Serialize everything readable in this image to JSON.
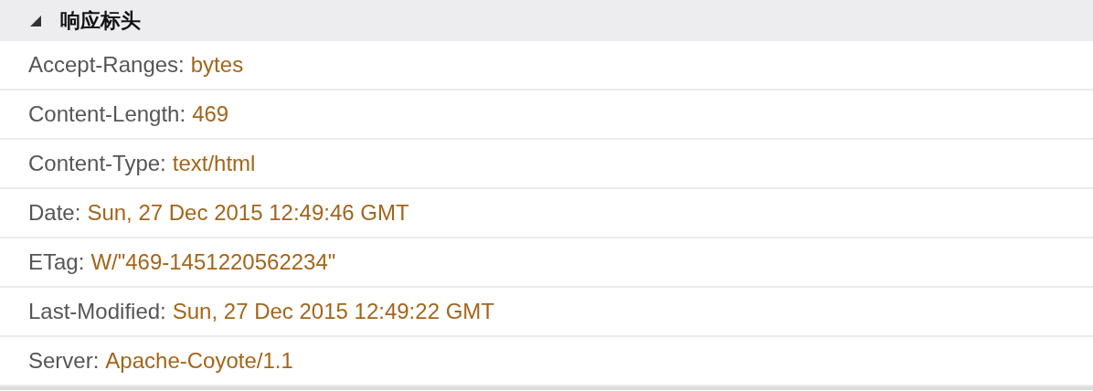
{
  "section": {
    "title": "响应标头",
    "expanded": true,
    "headers": [
      {
        "name": "Accept-Ranges:",
        "value": "bytes"
      },
      {
        "name": "Content-Length:",
        "value": "469"
      },
      {
        "name": "Content-Type:",
        "value": "text/html"
      },
      {
        "name": "Date:",
        "value": "Sun, 27 Dec 2015 12:49:46 GMT"
      },
      {
        "name": "ETag:",
        "value": "W/\"469-1451220562234\""
      },
      {
        "name": "Last-Modified:",
        "value": "Sun, 27 Dec 2015 12:49:22 GMT"
      },
      {
        "name": "Server:",
        "value": "Apache-Coyote/1.1"
      }
    ]
  }
}
